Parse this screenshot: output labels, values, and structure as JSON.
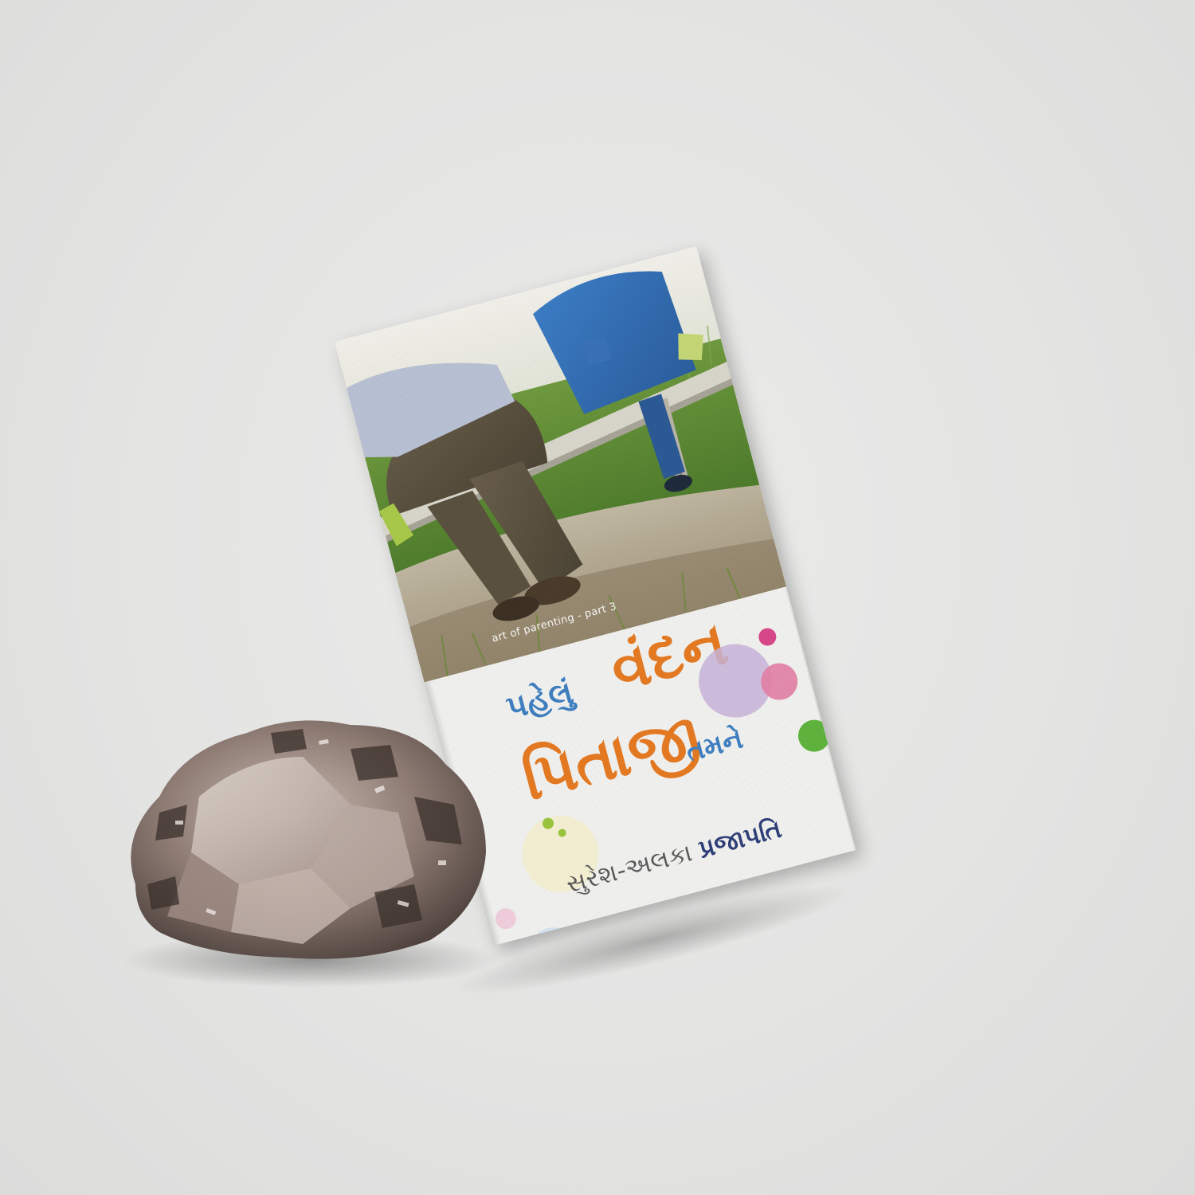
{
  "book": {
    "series": "art of parenting - part 3",
    "title_word1": "પહેલું",
    "title_word2": "વંદન",
    "title_word3": "પિતાજી",
    "title_word4": "તમને",
    "author_name": "સુરેશ-અલકા",
    "author_surname": "પ્રજાપતિ"
  },
  "colors": {
    "background": "#e5e5e4",
    "title_orange": "#e57a22",
    "title_blue": "#3f7fc1",
    "author_dark": "#2f3f78"
  }
}
